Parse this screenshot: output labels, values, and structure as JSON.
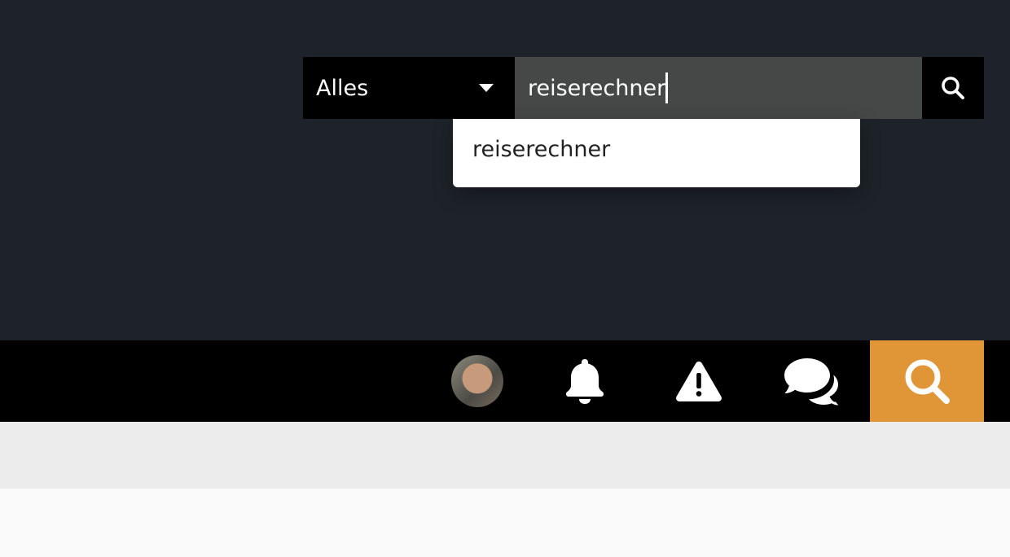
{
  "search": {
    "scope_value": "Alles",
    "query": "reiserechner",
    "suggestions": [
      "reiserechner"
    ]
  },
  "icons": {
    "scope_caret": "caret-down-icon",
    "search_submit": "search-icon",
    "notifications": "bell-icon",
    "alerts": "warning-icon",
    "messages": "chat-bubbles-icon",
    "nav_search": "search-icon"
  },
  "colors": {
    "panel_bg": "#1e232b",
    "input_bg": "#464848",
    "accent": "#e09537"
  }
}
